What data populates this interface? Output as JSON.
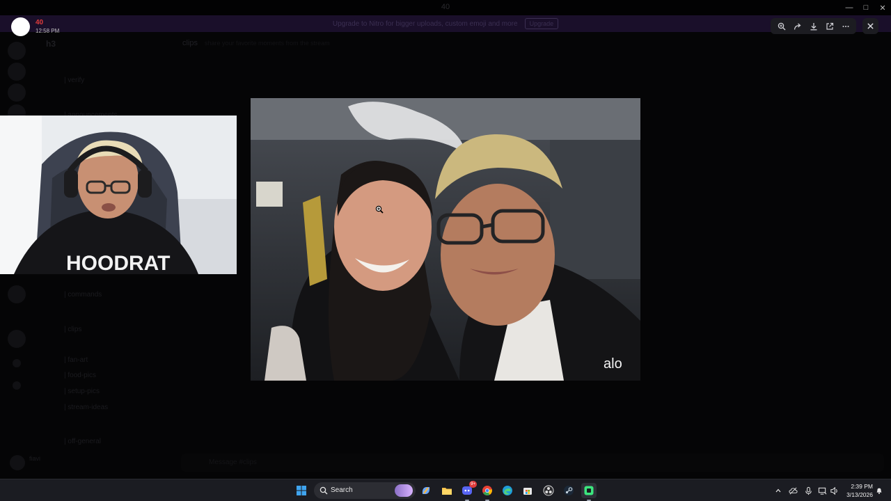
{
  "window": {
    "title": "40"
  },
  "banner": {
    "text": "Upgrade to Nitro for bigger uploads, custom emoji and more",
    "button": "Upgrade"
  },
  "discord": {
    "server_name": "h3",
    "channel_name": "clips",
    "channel_topic": "share your favorite moments from the stream",
    "channels": [
      {
        "label": "| verify",
        "y": 0
      },
      {
        "label": "| announcements",
        "y": 1
      },
      {
        "label": "| commands",
        "y": 2
      },
      {
        "label": "| clips",
        "y": 3
      },
      {
        "label": "| fan-art",
        "y": 4
      },
      {
        "label": "| food-pics",
        "y": 5
      },
      {
        "label": "| setup-pics",
        "y": 6
      },
      {
        "label": "| stream-ideas",
        "y": 7
      },
      {
        "label": "| off-general",
        "y": 8
      }
    ],
    "user_name": "fiavi",
    "message_placeholder": "Message #clips"
  },
  "viewer": {
    "uploader_name": "40",
    "upload_time": "12:58 PM",
    "tools": [
      "zoom-in-icon",
      "forward-icon",
      "download-icon",
      "open-external-icon",
      "more-icon"
    ],
    "photo_watermark": "alo"
  },
  "taskbar": {
    "search_label": "Search",
    "discord_badge": "9+",
    "time": "2:39 PM",
    "date": "3/13/2026"
  },
  "colors": {
    "accent_red": "#e03c3c",
    "taskbar": "#1b1c22",
    "tool_bg": "#1c1c21"
  }
}
